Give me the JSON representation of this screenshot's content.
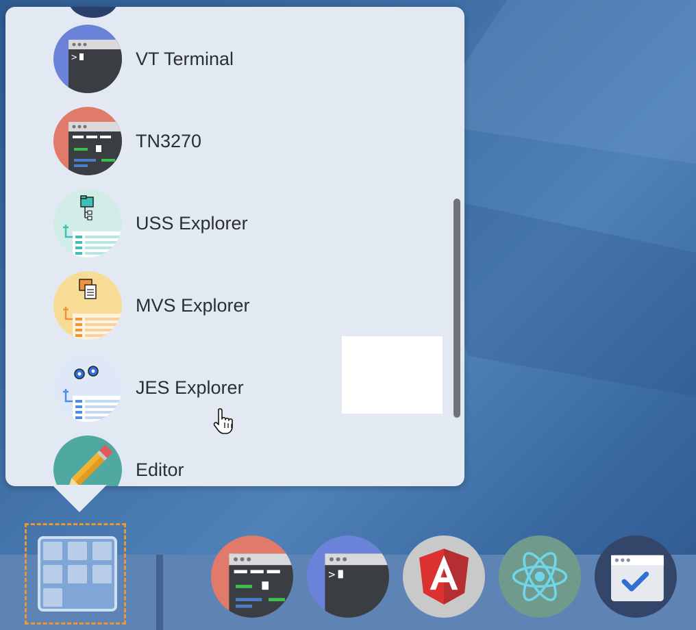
{
  "launcher": {
    "apps": [
      {
        "label": "VT Terminal",
        "icon": "vt-terminal-icon"
      },
      {
        "label": "TN3270",
        "icon": "tn3270-icon"
      },
      {
        "label": "USS Explorer",
        "icon": "uss-explorer-icon"
      },
      {
        "label": "MVS Explorer",
        "icon": "mvs-explorer-icon"
      },
      {
        "label": "JES Explorer",
        "icon": "jes-explorer-icon"
      },
      {
        "label": "Editor",
        "icon": "editor-icon"
      }
    ]
  },
  "taskbar": {
    "launcher_icon": "app-grid-icon",
    "apps": [
      {
        "icon": "tn3270-icon"
      },
      {
        "icon": "vt-terminal-icon"
      },
      {
        "icon": "angular-icon"
      },
      {
        "icon": "react-icon"
      },
      {
        "icon": "window-check-icon"
      }
    ]
  },
  "colors": {
    "desktop_bg": "#3f6fa6",
    "popup_bg": "#e2e9f3",
    "taskbar_bg": "#5d84b5",
    "focus_outline": "#f0962e"
  }
}
